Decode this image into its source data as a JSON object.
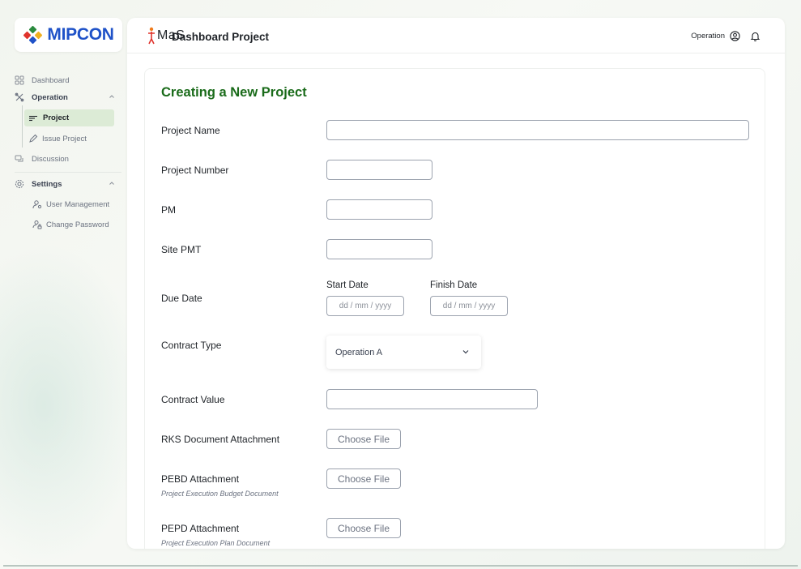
{
  "brand": {
    "logo_text": "MIPCON",
    "app_logo_text": "MaS"
  },
  "sidebar": {
    "items": [
      {
        "label": "Dashboard"
      },
      {
        "label": "Operation"
      },
      {
        "label": "Project"
      },
      {
        "label": "Issue Project"
      },
      {
        "label": "Discussion"
      },
      {
        "label": "Settings"
      },
      {
        "label": "User Management"
      },
      {
        "label": "Change Password"
      }
    ]
  },
  "header": {
    "title": "Dashboard Project",
    "user_label": "Operation"
  },
  "form": {
    "title": "Creating a New Project",
    "project_name_label": "Project Name",
    "project_name_value": "",
    "project_number_label": "Project Number",
    "project_number_value": "",
    "pm_label": "PM",
    "pm_value": "",
    "site_pmt_label": "Site PMT",
    "site_pmt_value": "",
    "due_date_label": "Due Date",
    "start_date_label": "Start Date",
    "start_date_placeholder": "dd / mm / yyyy",
    "finish_date_label": "Finish Date",
    "finish_date_placeholder": "dd / mm / yyyy",
    "contract_type_label": "Contract Type",
    "contract_type_value": "Operation A",
    "contract_value_label": "Contract Value",
    "contract_value_value": "",
    "rks_label": "RKS Document Attachment",
    "pebd_label": "PEBD Attachment",
    "pebd_sub": "Project Execution Budget Document",
    "pepd_label": "PEPD Attachment",
    "pepd_sub": "Project Execution Plan Document",
    "choose_file_label": "Choose File"
  },
  "colors": {
    "accent_green": "#1a6b1a",
    "brand_blue": "#1f52c8",
    "active_bg": "#dcebd6"
  }
}
